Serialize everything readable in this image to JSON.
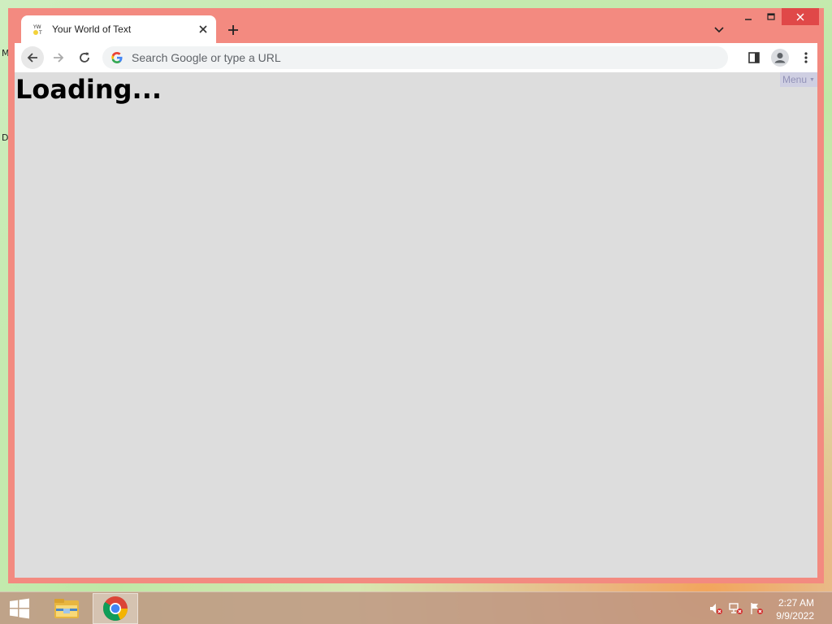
{
  "desktop": {
    "glyph_top": "M",
    "glyph_bottom": "D"
  },
  "window": {
    "caption": {
      "minimize_icon": "minimize-icon",
      "maximize_icon": "maximize-icon",
      "close_icon": "close-icon"
    },
    "tab": {
      "title": "Your World of Text",
      "favicon": "yw-ot-favicon"
    },
    "toolbar": {
      "omnibox_placeholder": "Search Google or type a URL"
    },
    "page": {
      "loading_text": "Loading...",
      "menu_label": "Menu"
    }
  },
  "taskbar": {
    "clock_time": "2:27 AM",
    "clock_date": "9/9/2022",
    "items": [
      "file-explorer",
      "google-chrome"
    ]
  },
  "colors": {
    "window_frame": "#f38a80",
    "page_background": "#dddddd",
    "menu_background": "#cfcfe2",
    "menu_text": "#9292b8"
  }
}
